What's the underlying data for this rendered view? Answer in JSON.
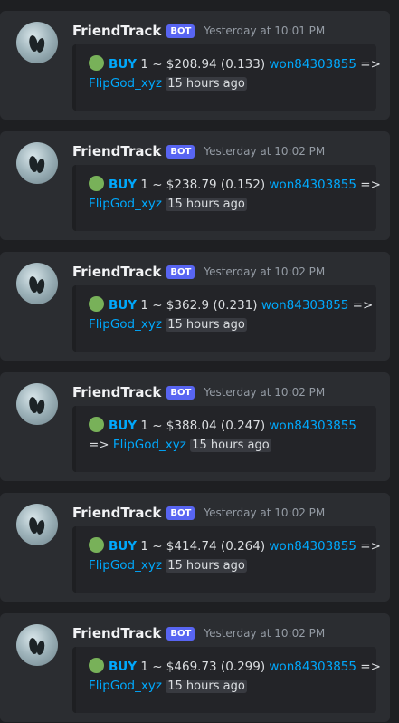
{
  "messages": [
    {
      "author": "FriendTrack",
      "tag": "BOT",
      "timestamp": "Yesterday at 10:01 PM",
      "emoji": "green-circle",
      "action": "BUY",
      "body": " 1 ~ $208.94 (0.133) ",
      "user": "won84303855",
      "arrow": " =>",
      "target": "FlipGod_xyz",
      "ago": "15 hours ago",
      "wrap": false
    },
    {
      "author": "FriendTrack",
      "tag": "BOT",
      "timestamp": "Yesterday at 10:02 PM",
      "emoji": "green-circle",
      "action": "BUY",
      "body": " 1 ~ $238.79 (0.152) ",
      "user": "won84303855",
      "arrow": " =>",
      "target": "FlipGod_xyz",
      "ago": "15 hours ago",
      "wrap": false
    },
    {
      "author": "FriendTrack",
      "tag": "BOT",
      "timestamp": "Yesterday at 10:02 PM",
      "emoji": "green-circle",
      "action": "BUY",
      "body": " 1 ~ $362.9 (0.231) ",
      "user": "won84303855",
      "arrow": " =>",
      "target": "FlipGod_xyz",
      "ago": "15 hours ago",
      "wrap": false
    },
    {
      "author": "FriendTrack",
      "tag": "BOT",
      "timestamp": "Yesterday at 10:02 PM",
      "emoji": "green-circle",
      "action": "BUY",
      "body": " 1 ~ $388.04 (0.247) ",
      "user": "won84303855",
      "arrow": "=> ",
      "target": "FlipGod_xyz",
      "ago": "15 hours ago",
      "wrap": true
    },
    {
      "author": "FriendTrack",
      "tag": "BOT",
      "timestamp": "Yesterday at 10:02 PM",
      "emoji": "green-circle",
      "action": "BUY",
      "body": " 1 ~ $414.74 (0.264) ",
      "user": "won84303855",
      "arrow": " =>",
      "target": "FlipGod_xyz",
      "ago": "15 hours ago",
      "wrap": false
    },
    {
      "author": "FriendTrack",
      "tag": "BOT",
      "timestamp": "Yesterday at 10:02 PM",
      "emoji": "green-circle",
      "action": "BUY",
      "body": " 1 ~ $469.73 (0.299) ",
      "user": "won84303855",
      "arrow": " =>",
      "target": "FlipGod_xyz",
      "ago": "15 hours ago",
      "wrap": false
    }
  ]
}
